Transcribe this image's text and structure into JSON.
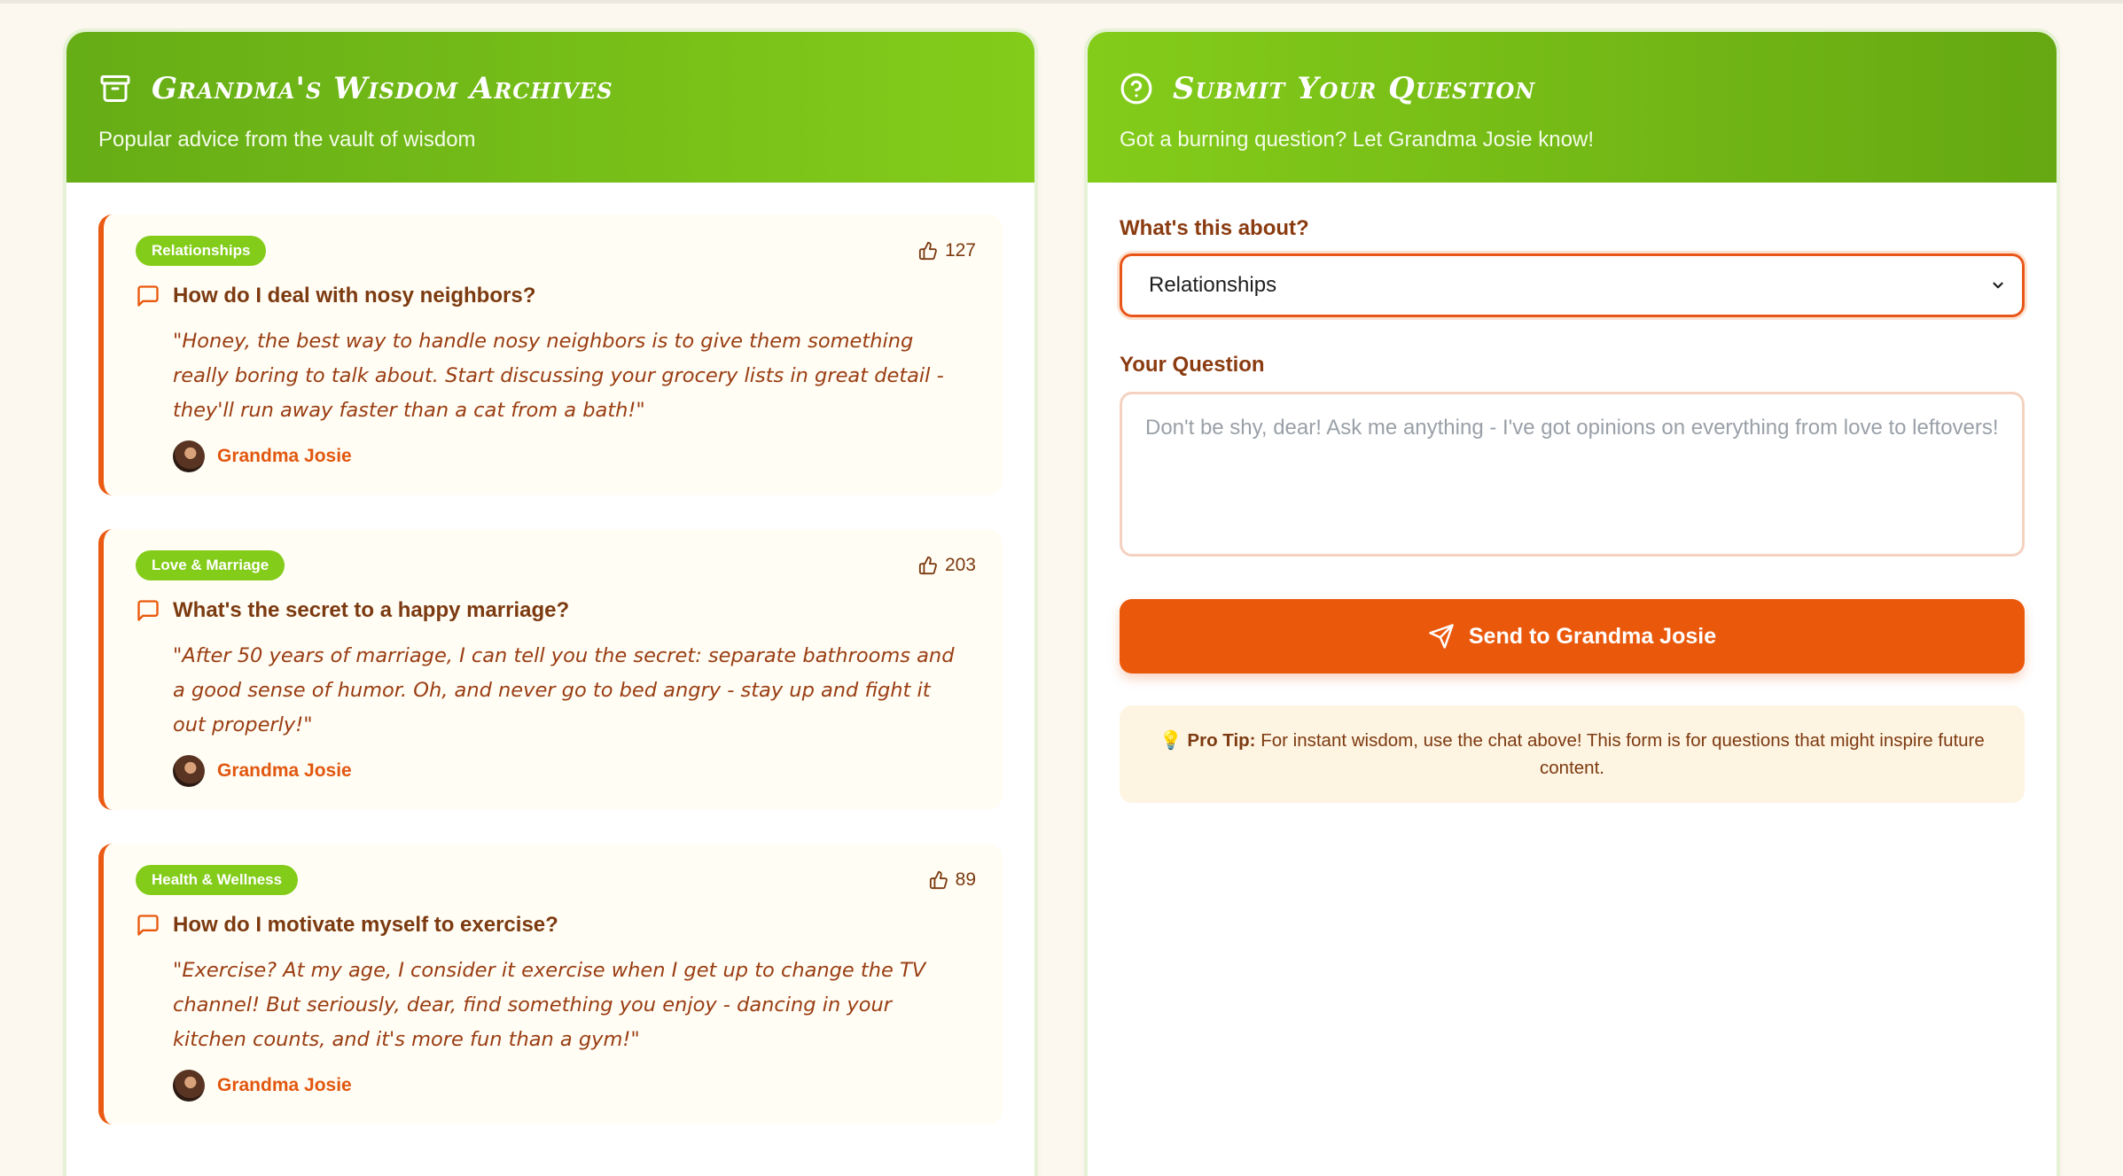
{
  "archive": {
    "title": "Grandma's Wisdom Archives",
    "subtitle": "Popular advice from the vault of wisdom",
    "entries": [
      {
        "tag": "Relationships",
        "likes": "127",
        "question": "How do I deal with nosy neighbors?",
        "answer": "\"Honey, the best way to handle nosy neighbors is to give them something really boring to talk about. Start discussing your grocery lists in great detail - they'll run away faster than a cat from a bath!\"",
        "author": "Grandma Josie"
      },
      {
        "tag": "Love & Marriage",
        "likes": "203",
        "question": "What's the secret to a happy marriage?",
        "answer": "\"After 50 years of marriage, I can tell you the secret: separate bathrooms and a good sense of humor. Oh, and never go to bed angry - stay up and fight it out properly!\"",
        "author": "Grandma Josie"
      },
      {
        "tag": "Health & Wellness",
        "likes": "89",
        "question": "How do I motivate myself to exercise?",
        "answer": "\"Exercise? At my age, I consider it exercise when I get up to change the TV channel! But seriously, dear, find something you enjoy - dancing in your kitchen counts, and it's more fun than a gym!\"",
        "author": "Grandma Josie"
      }
    ]
  },
  "submit": {
    "title": "Submit Your Question",
    "subtitle": "Got a burning question? Let Grandma Josie know!",
    "topic_label": "What's this about?",
    "topic_value": "Relationships",
    "question_label": "Your Question",
    "question_placeholder": "Don't be shy, dear! Ask me anything - I've got opinions on everything from love to leftovers!",
    "send_label": "Send to Grandma Josie",
    "tip_icon": "💡",
    "tip_bold": "Pro Tip:",
    "tip_text": "For instant wisdom, use the chat above! This form is for questions that might inspire future content."
  },
  "colors": {
    "header_green": "#84cc1a",
    "accent_orange": "#ea580c",
    "text_brown": "#7c3a10"
  }
}
